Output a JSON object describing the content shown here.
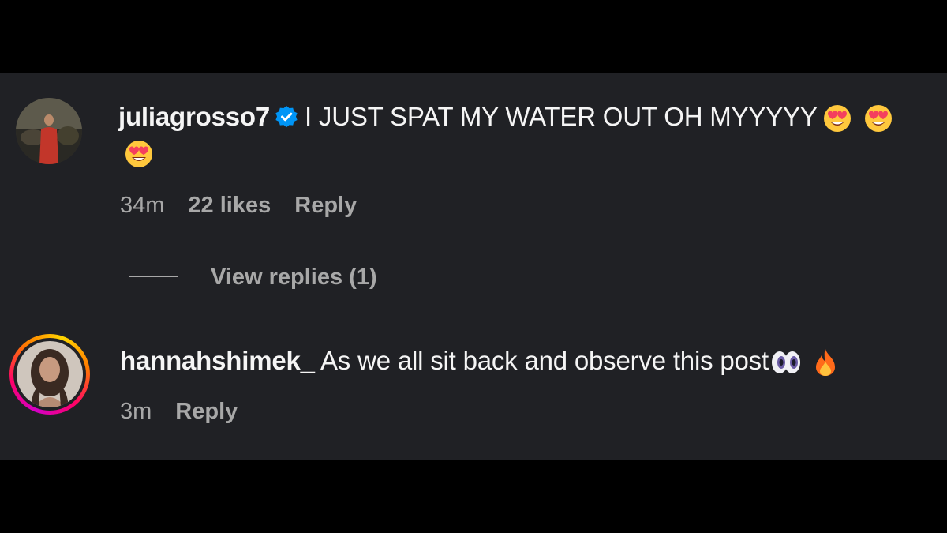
{
  "comments": [
    {
      "username": "juliagrosso7",
      "verified": true,
      "text": "I JUST SPAT MY WATER OUT OH MYYYYY",
      "emojis": [
        "heart-eyes-emoji",
        "heart-eyes-emoji",
        "heart-eyes-emoji"
      ],
      "time": "34m",
      "likes": "22 likes",
      "reply_label": "Reply",
      "view_replies": "View replies (1)"
    },
    {
      "username": "hannahshimek_",
      "verified": false,
      "story_ring": true,
      "text": "As we all sit back and observe this post",
      "emojis": [
        "eyes-emoji",
        "fire-emoji"
      ],
      "time": "3m",
      "reply_label": "Reply"
    }
  ],
  "colors": {
    "background": "#202125",
    "letterbox": "#000000",
    "text": "#f5f5f5",
    "muted": "#a8a8a8",
    "verified": "#0095f6"
  }
}
